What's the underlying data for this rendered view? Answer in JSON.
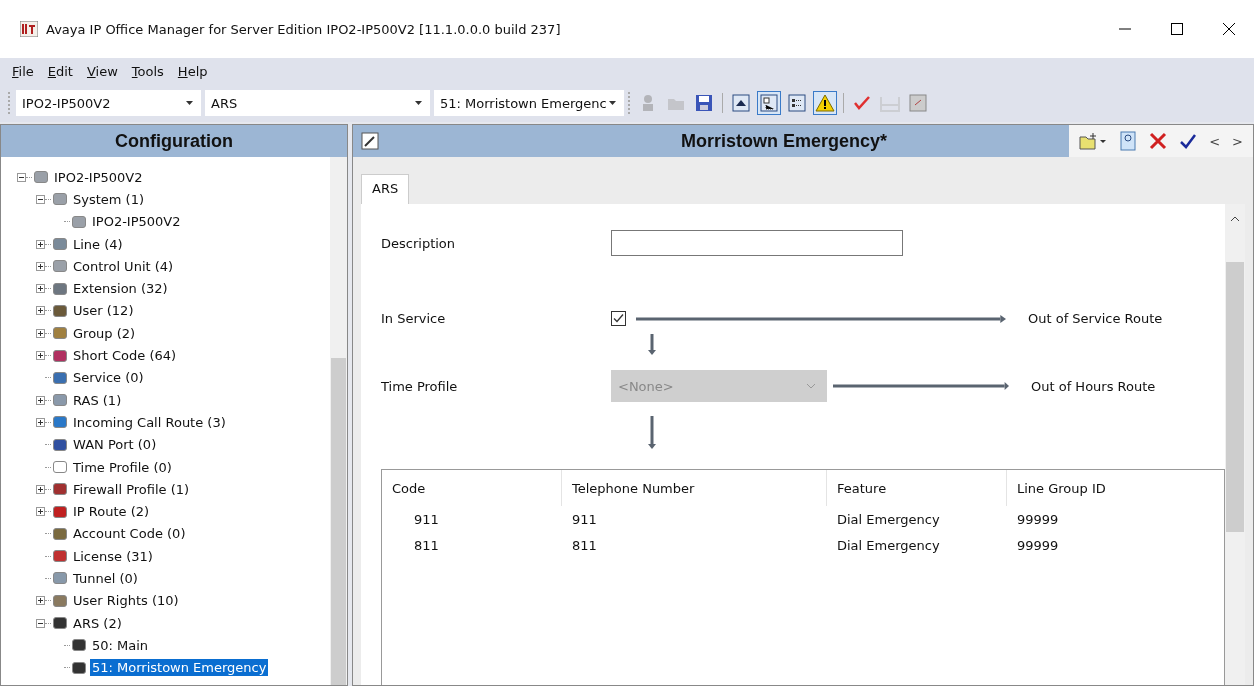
{
  "window": {
    "title": "Avaya IP Office Manager for Server Edition IPO2-IP500V2 [11.1.0.0.0 build 237]"
  },
  "menu": [
    {
      "label": "File"
    },
    {
      "label": "Edit"
    },
    {
      "label": "View"
    },
    {
      "label": "Tools"
    },
    {
      "label": "Help"
    }
  ],
  "toolbar": {
    "combos": [
      {
        "value": "IPO2-IP500V2"
      },
      {
        "value": "ARS"
      },
      {
        "value": "51: Morristown Emergenc"
      }
    ],
    "tools": [
      {
        "kind": "person",
        "disabled": true,
        "selected": false
      },
      {
        "kind": "folder",
        "disabled": true,
        "selected": false
      },
      {
        "kind": "save",
        "disabled": false,
        "selected": false
      },
      {
        "kind": "collapse",
        "disabled": false,
        "selected": false
      },
      {
        "kind": "tree",
        "disabled": false,
        "selected": true
      },
      {
        "kind": "list",
        "disabled": false,
        "selected": false
      },
      {
        "kind": "warning",
        "disabled": false,
        "selected": true
      },
      {
        "kind": "check",
        "disabled": false,
        "selected": false
      },
      {
        "kind": "cloud",
        "disabled": true,
        "selected": false
      },
      {
        "kind": "tile",
        "disabled": false,
        "selected": false
      }
    ]
  },
  "sidebar": {
    "title": "Configuration",
    "tree": [
      {
        "label": "IPO2-IP500V2",
        "kind": "device",
        "expanded": true,
        "selected": false,
        "children": [
          {
            "label": "System (1)",
            "kind": "device",
            "expanded": true,
            "selected": false,
            "children": [
              {
                "label": "IPO2-IP500V2",
                "kind": "device",
                "selected": false
              }
            ]
          },
          {
            "label": "Line (4)",
            "kind": "line",
            "expanded": false,
            "selected": false
          },
          {
            "label": "Control Unit (4)",
            "kind": "device",
            "expanded": false,
            "selected": false
          },
          {
            "label": "Extension (32)",
            "kind": "phone",
            "expanded": false,
            "selected": false
          },
          {
            "label": "User (12)",
            "kind": "user",
            "expanded": false,
            "selected": false
          },
          {
            "label": "Group (2)",
            "kind": "group",
            "expanded": false,
            "selected": false
          },
          {
            "label": "Short Code (64)",
            "kind": "shortcode",
            "expanded": false,
            "selected": false
          },
          {
            "label": "Service (0)",
            "kind": "globe",
            "selected": false
          },
          {
            "label": "RAS (1)",
            "kind": "ras",
            "expanded": false,
            "selected": false
          },
          {
            "label": "Incoming Call Route (3)",
            "kind": "route",
            "expanded": false,
            "selected": false
          },
          {
            "label": "WAN Port (0)",
            "kind": "wan",
            "selected": false
          },
          {
            "label": "Time Profile (0)",
            "kind": "clock",
            "selected": false
          },
          {
            "label": "Firewall Profile (1)",
            "kind": "firewall",
            "expanded": false,
            "selected": false
          },
          {
            "label": "IP Route (2)",
            "kind": "iproute",
            "expanded": false,
            "selected": false
          },
          {
            "label": "Account Code (0)",
            "kind": "account",
            "selected": false
          },
          {
            "label": "License (31)",
            "kind": "license",
            "selected": false
          },
          {
            "label": "Tunnel (0)",
            "kind": "tunnel",
            "selected": false
          },
          {
            "label": "User Rights (10)",
            "kind": "rights",
            "expanded": false,
            "selected": false
          },
          {
            "label": "ARS (2)",
            "kind": "ars",
            "expanded": true,
            "selected": false,
            "children": [
              {
                "label": "50: Main",
                "kind": "ars",
                "selected": false
              },
              {
                "label": "51: Morristown Emergency",
                "kind": "ars",
                "selected": true
              }
            ]
          }
        ]
      }
    ]
  },
  "editor": {
    "title": "Morristown Emergency*",
    "actions": [
      {
        "kind": "new"
      },
      {
        "kind": "export"
      },
      {
        "kind": "delete"
      },
      {
        "kind": "ok"
      },
      {
        "kind": "text",
        "label": "<"
      },
      {
        "kind": "text",
        "label": ">"
      }
    ],
    "tabs": [
      {
        "label": "ARS",
        "selected": true
      }
    ],
    "description": {
      "label": "Description"
    },
    "in_service": {
      "label": "In Service",
      "checked": true,
      "route": "Out of Service Route"
    },
    "time_profile": {
      "label": "Time Profile",
      "value": "<None>",
      "disabled": true,
      "route": "Out of Hours Route"
    },
    "table": {
      "columns": [
        "Code",
        "Telephone Number",
        "Feature",
        "Line Group ID"
      ],
      "rows": [
        [
          "911",
          "911",
          "Dial Emergency",
          "99999"
        ],
        [
          "811",
          "811",
          "Dial Emergency",
          "99999"
        ]
      ]
    }
  }
}
